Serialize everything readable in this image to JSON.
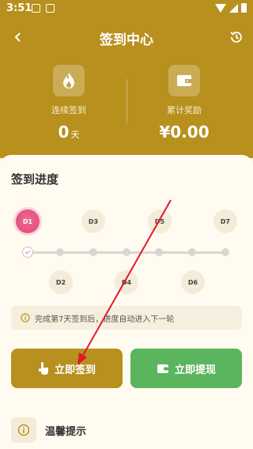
{
  "status_bar": {
    "time": "3:51"
  },
  "header": {
    "title": "签到中心"
  },
  "stats": {
    "streak_label": "连续签到",
    "streak_value": "0",
    "streak_unit": "天",
    "reward_label": "累计奖励",
    "reward_value": "¥0.00"
  },
  "progress": {
    "title": "签到进度",
    "days": [
      "D1",
      "D2",
      "D3",
      "D4",
      "D5",
      "D6",
      "D7"
    ],
    "current_day": "D1"
  },
  "notice": {
    "text": "完成第7天签到后，进度自动进入下一轮"
  },
  "actions": {
    "checkin_label": "立即签到",
    "withdraw_label": "立即提现"
  },
  "tips": {
    "title": "温馨提示"
  },
  "colors": {
    "brand": "#b8901e",
    "active_day": "#e0457a",
    "withdraw": "#5bb45e",
    "annotation_arrow": "#e0182d"
  }
}
